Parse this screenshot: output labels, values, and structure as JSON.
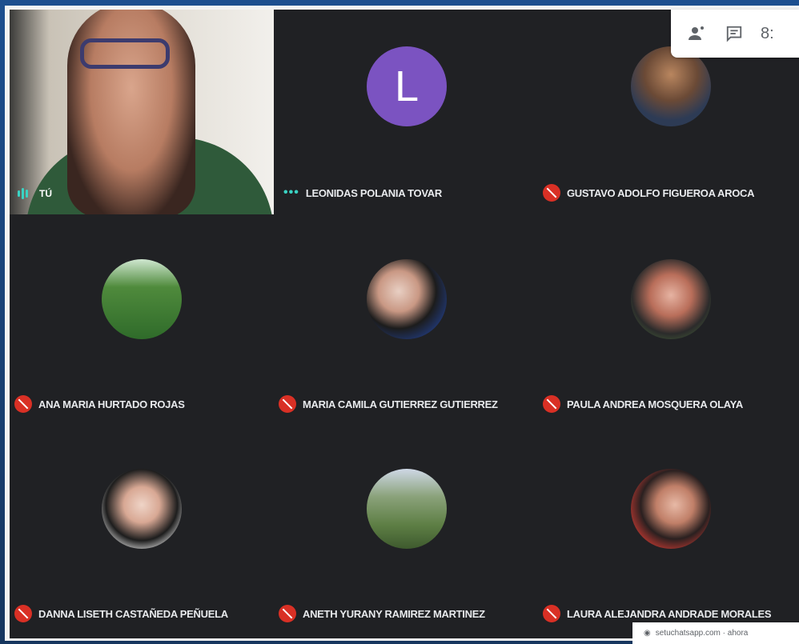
{
  "participants": {
    "self": {
      "name": "TÚ",
      "speaking": true
    },
    "leonidas": {
      "name": "LEONIDAS POLANIA TOVAR",
      "initial": "L",
      "avatar_color": "#7b53c1"
    },
    "gustavo": {
      "name": "GUSTAVO ADOLFO FIGUEROA AROCA"
    },
    "ana": {
      "name": "ANA MARIA HURTADO ROJAS"
    },
    "maria": {
      "name": "MARIA CAMILA GUTIERREZ GUTIERREZ"
    },
    "paula": {
      "name": "PAULA ANDREA MOSQUERA OLAYA"
    },
    "danna": {
      "name": "DANNA LISETH CASTAÑEDA PEÑUELA"
    },
    "aneth": {
      "name": "ANETH YURANY RAMIREZ MARTINEZ"
    },
    "laura": {
      "name": "LAURA ALEJANDRA ANDRADE MORALES"
    }
  },
  "top_panel": {
    "people_icon": "people-icon",
    "chat_icon": "chat-icon",
    "clock_text": "8:"
  },
  "bottom_bar": {
    "text": "setuchatsapp.com · ahora"
  },
  "colors": {
    "background": "#202124",
    "mic_off": "#d93025",
    "accent": "#3ad3c4"
  }
}
